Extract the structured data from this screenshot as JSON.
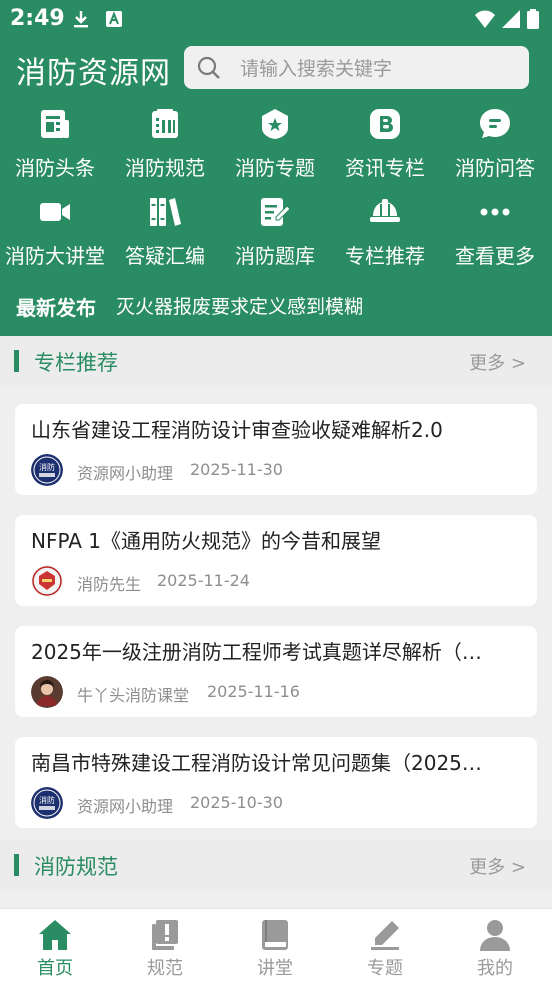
{
  "status": {
    "time": "2:49"
  },
  "header": {
    "app_title": "消防资源网",
    "search_placeholder": "请输入搜索关键字"
  },
  "nav_row1": [
    {
      "label": "消防头条",
      "icon": "news-icon"
    },
    {
      "label": "消防规范",
      "icon": "spec-icon"
    },
    {
      "label": "消防专题",
      "icon": "topic-icon"
    },
    {
      "label": "资讯专栏",
      "icon": "blog-icon"
    },
    {
      "label": "消防问答",
      "icon": "chat-icon"
    }
  ],
  "nav_row2": [
    {
      "label": "消防大讲堂",
      "icon": "video-icon"
    },
    {
      "label": "答疑汇编",
      "icon": "books-icon"
    },
    {
      "label": "消防题库",
      "icon": "edit-icon"
    },
    {
      "label": "专栏推荐",
      "icon": "helmet-icon"
    },
    {
      "label": "查看更多",
      "icon": "more-icon"
    }
  ],
  "latest": {
    "label": "最新发布",
    "text": "灭火器报废要求定义感到模糊"
  },
  "section1": {
    "title": "专栏推荐",
    "more": "更多 >"
  },
  "articles": [
    {
      "title": "山东省建设工程消防设计审查验收疑难解析2.0",
      "author": "资源网小助理",
      "date": "2025-11-30"
    },
    {
      "title": "NFPA 1《通用防火规范》的今昔和展望",
      "author": "消防先生",
      "date": "2025-11-24"
    },
    {
      "title": "2025年一级注册消防工程师考试真题详尽解析（…",
      "author": "牛丫头消防课堂",
      "date": "2025-11-16"
    },
    {
      "title": "南昌市特殊建设工程消防设计常见问题集（2025…",
      "author": "资源网小助理",
      "date": "2025-10-30"
    }
  ],
  "section2": {
    "title": "消防规范",
    "more": "更多 >"
  },
  "tabs": [
    {
      "label": "首页",
      "active": true
    },
    {
      "label": "规范",
      "active": false
    },
    {
      "label": "讲堂",
      "active": false
    },
    {
      "label": "专题",
      "active": false
    },
    {
      "label": "我的",
      "active": false
    }
  ],
  "colors": {
    "brand": "#2a8c63",
    "muted": "#9a9a9a"
  }
}
